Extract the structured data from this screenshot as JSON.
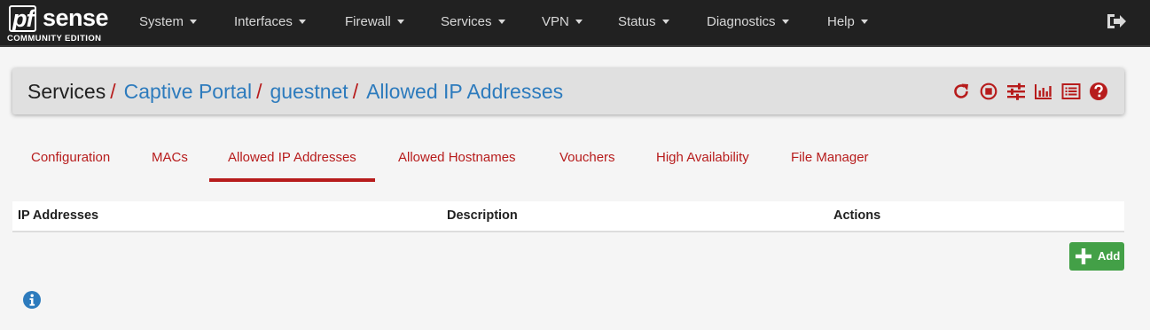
{
  "brand": {
    "pf": "pf",
    "sense": "sense",
    "edition": "COMMUNITY EDITION"
  },
  "nav": {
    "items": [
      {
        "label": "System"
      },
      {
        "label": "Interfaces"
      },
      {
        "label": "Firewall"
      },
      {
        "label": "Services"
      },
      {
        "label": "VPN"
      },
      {
        "label": "Status"
      },
      {
        "label": "Diagnostics"
      },
      {
        "label": "Help"
      }
    ],
    "logout_icon": "sign-out-icon"
  },
  "breadcrumb": {
    "root": "Services",
    "level1": "Captive Portal",
    "level2": "guestnet",
    "current": "Allowed IP Addresses",
    "separator": "/",
    "icons": [
      "restart-icon",
      "stop-icon",
      "settings-sliders-icon",
      "bar-chart-icon",
      "list-log-icon",
      "help-icon"
    ]
  },
  "tabs": [
    {
      "label": "Configuration"
    },
    {
      "label": "MACs"
    },
    {
      "label": "Allowed IP Addresses",
      "active": true
    },
    {
      "label": "Allowed Hostnames"
    },
    {
      "label": "Vouchers"
    },
    {
      "label": "High Availability"
    },
    {
      "label": "File Manager"
    }
  ],
  "table": {
    "headers": [
      "IP Addresses",
      "Description",
      "Actions"
    ],
    "rows": []
  },
  "actions": {
    "add_label": "Add",
    "add_icon": "plus-icon"
  },
  "info_icon": "info-circle-icon",
  "colors": {
    "navbar": "#212121",
    "accent_red": "#b71c1c",
    "link_blue": "#2d7bbd",
    "add_green": "#43a047",
    "info_blue": "#2d7bbd"
  }
}
